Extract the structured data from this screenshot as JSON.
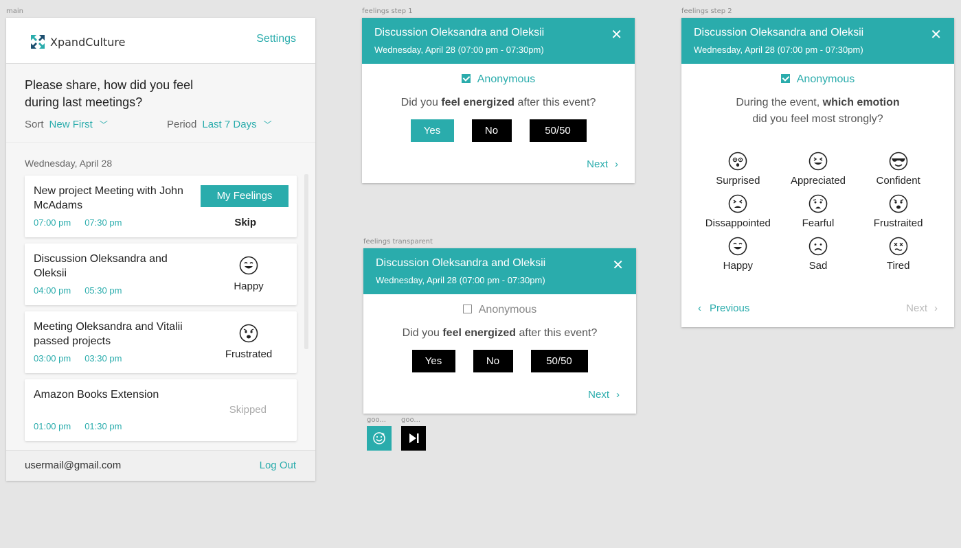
{
  "frames": {
    "main": "main",
    "step1": "feelings step 1",
    "step2": "feelings step 2",
    "transparent": "feelings transparent",
    "mini1": "goo...",
    "mini2": "goo..."
  },
  "main": {
    "logo_text": "XpandCulture",
    "settings_label": "Settings",
    "intro_title": "Please share, how did you feel during last meetings?",
    "sort_label": "Sort",
    "sort_value": "New First",
    "period_label": "Period",
    "period_value": "Last 7 Days",
    "date_header": "Wednesday, April 28",
    "cards": [
      {
        "title": "New project Meeting with John McAdams",
        "start": "07:00 pm",
        "end": "07:30 pm",
        "action_label": "My Feelings",
        "skip_label": "Skip"
      },
      {
        "title": "Discussion Oleksandra and Oleksii",
        "start": "04:00 pm",
        "end": "05:30 pm",
        "emotion": "Happy",
        "emotion_icon": "happy-face-icon"
      },
      {
        "title": "Meeting Oleksandra and Vitalii passed projects",
        "start": "03:00 pm",
        "end": "03:30 pm",
        "emotion": "Frustrated",
        "emotion_icon": "frustrated-face-icon"
      },
      {
        "title": "Amazon Books Extension",
        "start": "01:00 pm",
        "end": "01:30 pm",
        "status": "Skipped"
      }
    ],
    "user_email": "usermail@gmail.com",
    "logout_label": "Log Out"
  },
  "step1": {
    "title": "Discussion Oleksandra and Oleksii",
    "subtitle": "Wednesday, April 28 (07:00 pm - 07:30pm)",
    "anonymous_label": "Anonymous",
    "anonymous_checked": true,
    "question_pre": "Did you ",
    "question_bold": "feel energized",
    "question_post": " after this event?",
    "answers": [
      "Yes",
      "No",
      "50/50"
    ],
    "selected_answer": "Yes",
    "next_label": "Next"
  },
  "transparent": {
    "title": "Discussion Oleksandra and Oleksii",
    "subtitle": "Wednesday, April 28 (07:00 pm - 07:30pm)",
    "anonymous_label": "Anonymous",
    "anonymous_checked": false,
    "question_pre": "Did you ",
    "question_bold": "feel energized",
    "question_post": " after this event?",
    "answers": [
      "Yes",
      "No",
      "50/50"
    ],
    "next_label": "Next"
  },
  "step2": {
    "title": "Discussion Oleksandra and Oleksii",
    "subtitle": "Wednesday, April 28 (07:00 pm - 07:30pm)",
    "anonymous_label": "Anonymous",
    "anonymous_checked": true,
    "question_pre": "During the event, ",
    "question_bold": "which emotion",
    "question_line2": "did you feel most strongly?",
    "emotions": [
      "Surprised",
      "Appreciated",
      "Confident",
      "Dissappointed",
      "Fearful",
      "Frustraited",
      "Happy",
      "Sad",
      "Tired"
    ],
    "previous_label": "Previous",
    "next_label": "Next"
  },
  "colors": {
    "accent": "#2aacac",
    "button_dark": "#000000"
  }
}
